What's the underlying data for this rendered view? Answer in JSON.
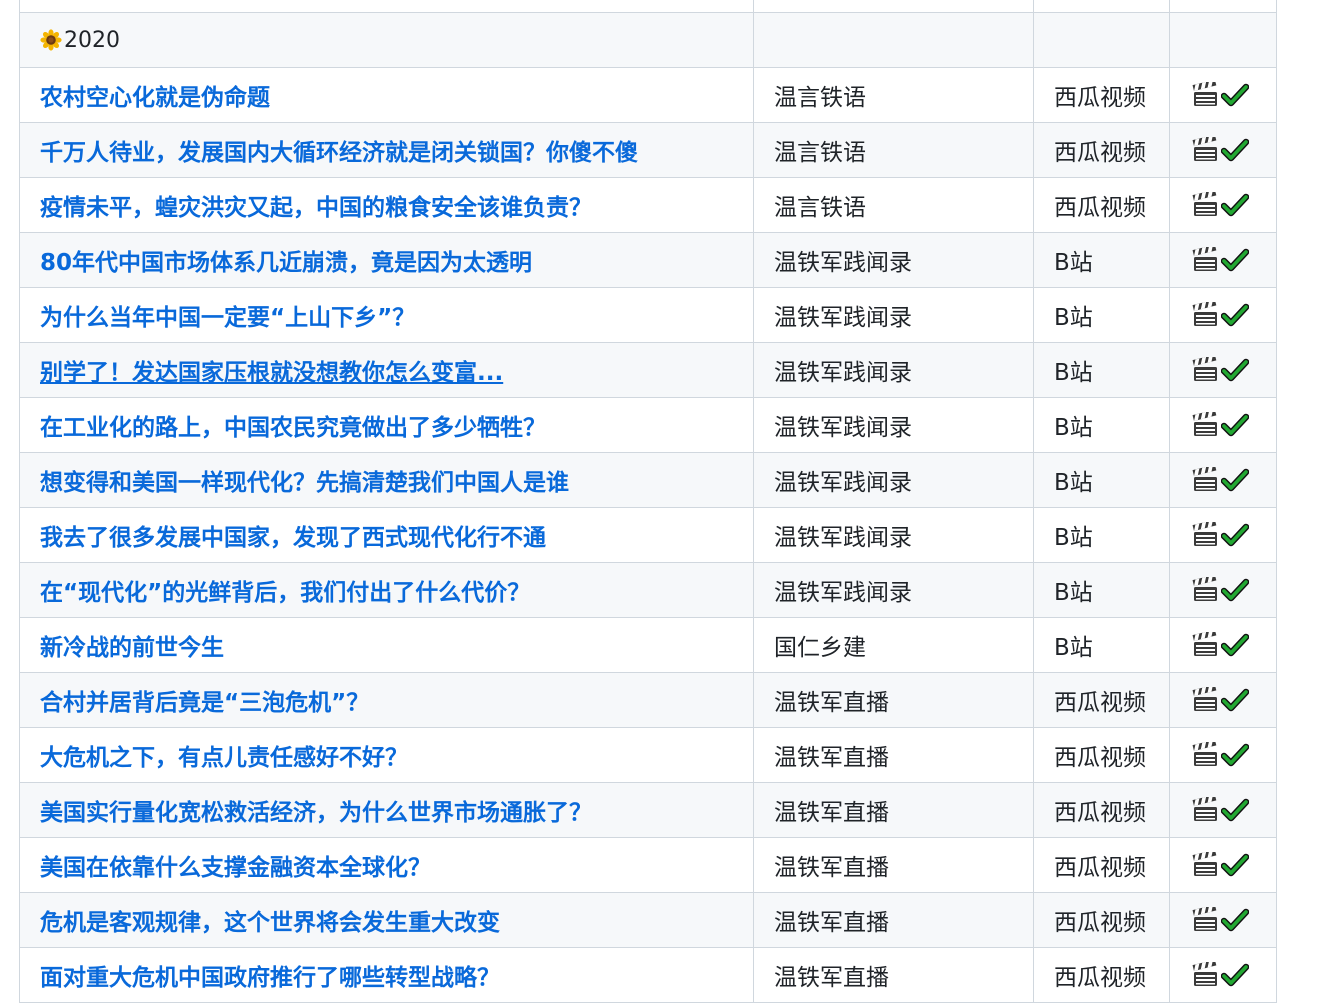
{
  "section_year": "2020",
  "year_icon": "sunflower-icon",
  "status_icons": [
    "clapper-board-icon",
    "check-mark-icon"
  ],
  "colors": {
    "link": "#0969da",
    "text": "#1f2328",
    "border": "#d0d7de",
    "row_alt": "#f6f8fa",
    "check": "#22a832"
  },
  "rows": [
    {
      "title": "农村空心化就是伪命题",
      "source": "温言铁语",
      "platform": "西瓜视频"
    },
    {
      "title": "千万人待业，发展国内大循环经济就是闭关锁国？你傻不傻",
      "source": "温言铁语",
      "platform": "西瓜视频"
    },
    {
      "title": "疫情未平，蝗灾洪灾又起，中国的粮食安全该谁负责？",
      "source": "温言铁语",
      "platform": "西瓜视频"
    },
    {
      "title": "80年代中国市场体系几近崩溃，竟是因为太透明",
      "source": "温铁军践闻录",
      "platform": "B站"
    },
    {
      "title": "为什么当年中国一定要“上山下乡”？",
      "source": "温铁军践闻录",
      "platform": "B站"
    },
    {
      "title": "别学了！发达国家压根就没想教你怎么变富...",
      "source": "温铁军践闻录",
      "platform": "B站"
    },
    {
      "title": "在工业化的路上，中国农民究竟做出了多少牺牲？",
      "source": "温铁军践闻录",
      "platform": "B站"
    },
    {
      "title": "想变得和美国一样现代化？先搞清楚我们中国人是谁",
      "source": "温铁军践闻录",
      "platform": "B站"
    },
    {
      "title": "我去了很多发展中国家，发现了西式现代化行不通",
      "source": "温铁军践闻录",
      "platform": "B站"
    },
    {
      "title": "在“现代化”的光鲜背后，我们付出了什么代价？",
      "source": "温铁军践闻录",
      "platform": "B站"
    },
    {
      "title": "新冷战的前世今生",
      "source": "国仁乡建",
      "platform": "B站"
    },
    {
      "title": "合村并居背后竟是“三泡危机”？",
      "source": "温铁军直播",
      "platform": "西瓜视频"
    },
    {
      "title": "大危机之下，有点儿责任感好不好？",
      "source": "温铁军直播",
      "platform": "西瓜视频"
    },
    {
      "title": "美国实行量化宽松救活经济，为什么世界市场通胀了？",
      "source": "温铁军直播",
      "platform": "西瓜视频"
    },
    {
      "title": "美国在依靠什么支撑金融资本全球化？",
      "source": "温铁军直播",
      "platform": "西瓜视频"
    },
    {
      "title": "危机是客观规律，这个世界将会发生重大改变",
      "source": "温铁军直播",
      "platform": "西瓜视频"
    },
    {
      "title": "面对重大危机中国政府推行了哪些转型战略？",
      "source": "温铁军直播",
      "platform": "西瓜视频"
    }
  ]
}
